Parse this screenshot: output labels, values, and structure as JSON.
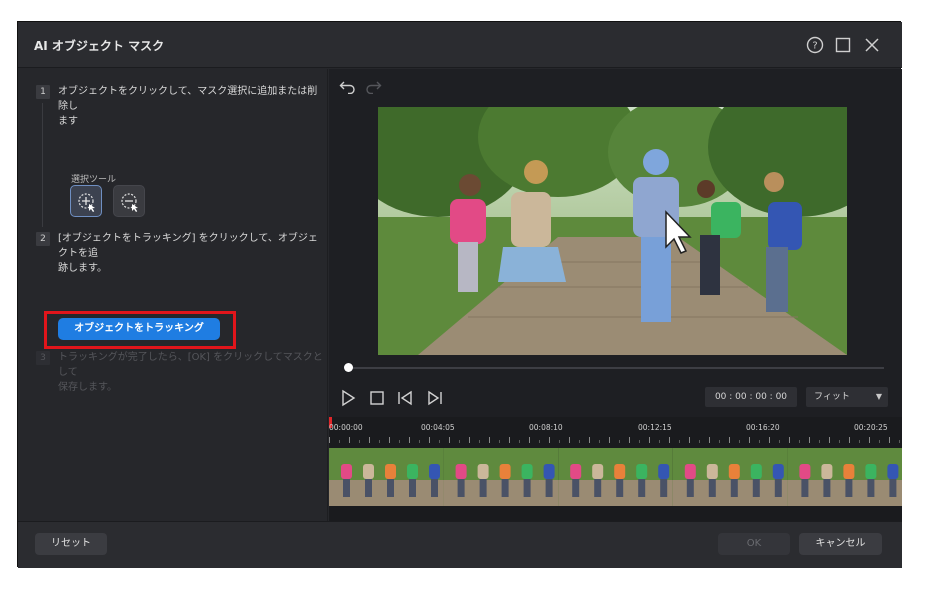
{
  "window": {
    "title": "AI オブジェクト マスク",
    "help_icon": "help-circle-icon",
    "maximize_icon": "maximize-square-icon",
    "close_icon": "close-x-icon"
  },
  "steps": [
    {
      "num": "1",
      "text_line1": "オブジェクトをクリックして、マスク選択に追加または削除し",
      "text_line2": "ます"
    },
    {
      "num": "2",
      "text_line1": "[オブジェクトをトラッキング] をクリックして、オブジェクトを追",
      "text_line2": "跡します。"
    },
    {
      "num": "3",
      "text_line1": "トラッキングが完了したら、[OK] をクリックしてマスクとして",
      "text_line2": "保存します。"
    }
  ],
  "selection_tool": {
    "label": "選択ツール",
    "add_icon": "add-selection-icon",
    "remove_icon": "remove-selection-icon"
  },
  "track_button_label": "オブジェクトをトラッキング",
  "player": {
    "undo_icon": "undo-icon",
    "redo_icon": "redo-icon",
    "play_icon": "play-icon",
    "stop_icon": "stop-icon",
    "prev_frame_icon": "prev-frame-icon",
    "next_frame_icon": "next-frame-icon",
    "timecode": "00 : 00 : 00 : 00",
    "zoom_label": "フィット",
    "seek_progress": 0.0
  },
  "timeline": {
    "labels": [
      "00:00:00",
      "00:04:05",
      "00:08:10",
      "00:12:15",
      "00:16:20",
      "00:20:25"
    ]
  },
  "footer": {
    "reset_label": "リセット",
    "ok_label": "OK",
    "cancel_label": "キャンセル"
  },
  "colors": {
    "accent": "#1f7de2",
    "highlight": "#e1151b",
    "background": "#26272b"
  }
}
